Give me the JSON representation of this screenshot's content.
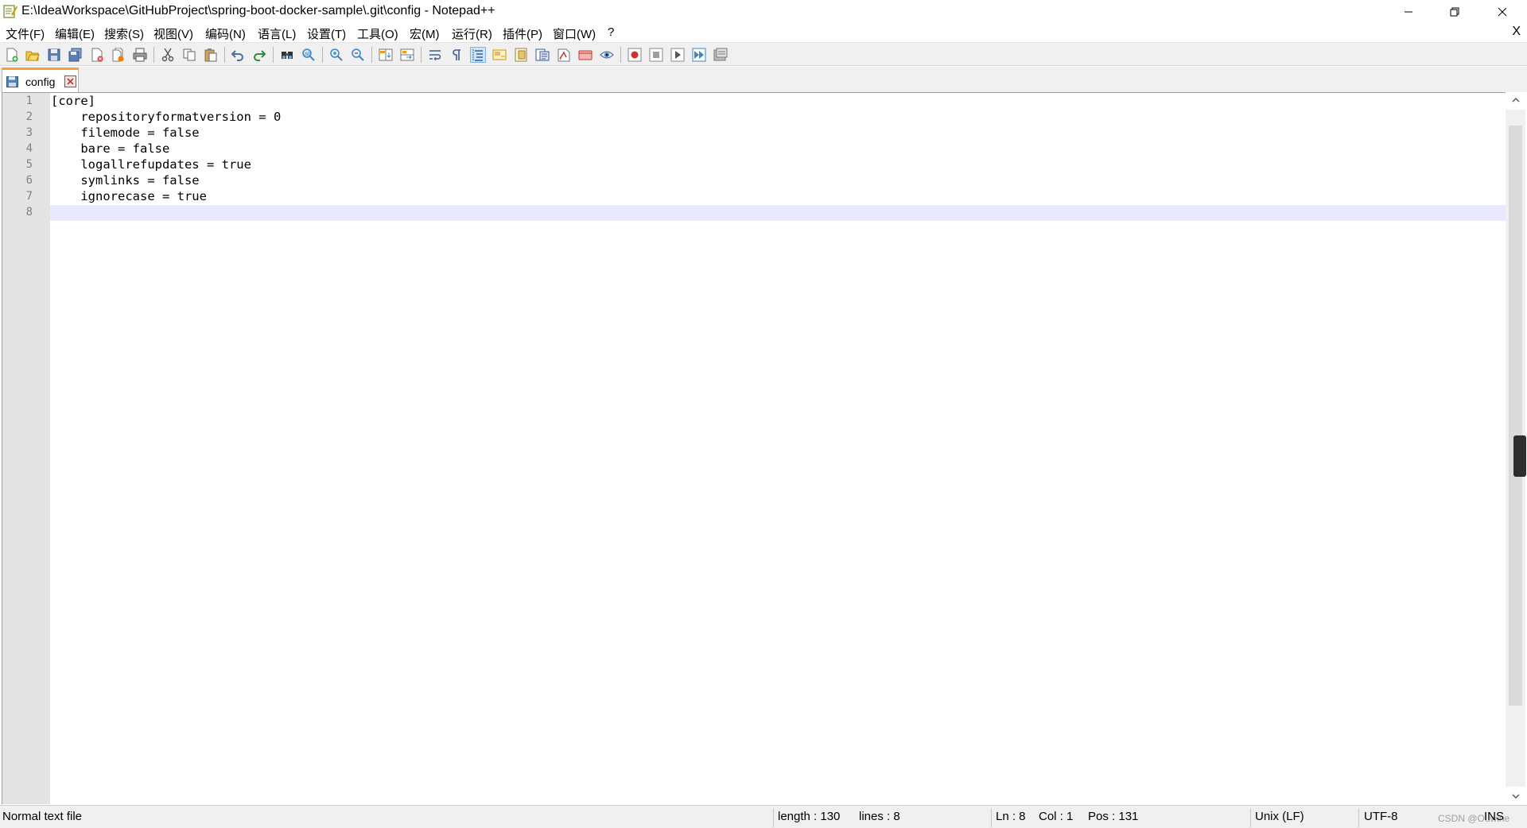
{
  "window": {
    "title": "E:\\IdeaWorkspace\\GitHubProject\\spring-boot-docker-sample\\.git\\config - Notepad++",
    "minimize_glyph": "─",
    "restore_glyph": "❐",
    "close_glyph": "✕"
  },
  "menu": {
    "items": [
      "文件(F)",
      "编辑(E)",
      "搜索(S)",
      "视图(V)",
      "编码(N)",
      "语言(L)",
      "设置(T)",
      "工具(O)",
      "宏(M)",
      "运行(R)",
      "插件(P)",
      "窗口(W)",
      "?"
    ],
    "close_doc": "X"
  },
  "toolbar": {
    "icons": [
      "new-file-icon",
      "open-file-icon",
      "save-icon",
      "save-all-icon",
      "close-icon",
      "close-all-icon",
      "print-icon",
      "cut-icon",
      "copy-icon",
      "paste-icon",
      "undo-icon",
      "redo-icon",
      "find-icon",
      "replace-icon",
      "zoom-in-icon",
      "zoom-out-icon",
      "sync-vertical-icon",
      "sync-horizontal-icon",
      "word-wrap-icon",
      "show-all-chars-icon",
      "indent-guide-icon",
      "user-lang-icon",
      "doc-map-icon",
      "function-list-icon",
      "folder-workspace-icon",
      "doc-monitor-icon",
      "monitor-icon",
      "record-macro-icon",
      "stop-record-icon",
      "play-macro-icon",
      "run-macro-multiple-icon",
      "save-macro-icon"
    ]
  },
  "tab": {
    "label": "config"
  },
  "editor": {
    "lines": [
      {
        "no": "1",
        "text": "[core]"
      },
      {
        "no": "2",
        "text": "    repositoryformatversion = 0"
      },
      {
        "no": "3",
        "text": "    filemode = false"
      },
      {
        "no": "4",
        "text": "    bare = false"
      },
      {
        "no": "5",
        "text": "    logallrefupdates = true"
      },
      {
        "no": "6",
        "text": "    symlinks = false"
      },
      {
        "no": "7",
        "text": "    ignorecase = true"
      },
      {
        "no": "8",
        "text": ""
      }
    ],
    "current_line": 8
  },
  "status": {
    "file_type": "Normal text file",
    "length": "length : 130",
    "lines": "lines : 8",
    "ln": "Ln : 8",
    "col": "Col : 1",
    "pos": "Pos : 131",
    "eol": "Unix (LF)",
    "encoding": "UTF-8",
    "mode": "INS",
    "watermark": "CSDN @Ouwine"
  },
  "colors": {
    "tab_accent": "#fa9f32",
    "current_line": "#e8e8ff",
    "gutter": "#e4e4e4",
    "line_number": "#808080"
  }
}
